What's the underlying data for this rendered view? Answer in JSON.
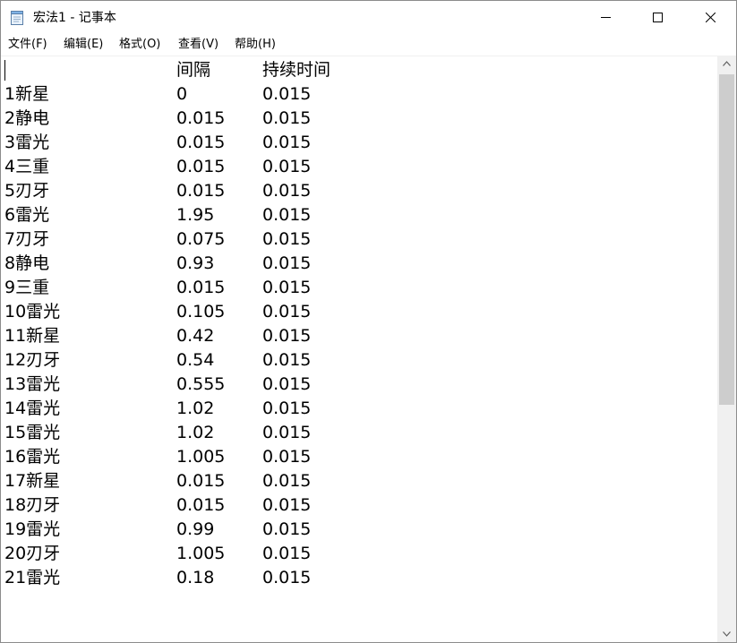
{
  "window": {
    "title": "宏法1 - 记事本"
  },
  "menu": [
    {
      "label": "文件(F)"
    },
    {
      "label": "编辑(E)"
    },
    {
      "label": "格式(O)"
    },
    {
      "label": "查看(V)"
    },
    {
      "label": "帮助(H)"
    }
  ],
  "document": {
    "header": {
      "name": "",
      "interval": "间隔",
      "duration": "持续时间"
    },
    "rows": [
      {
        "name": "1新星",
        "interval": "0",
        "duration": "0.015"
      },
      {
        "name": "2静电",
        "interval": "0.015",
        "duration": "0.015"
      },
      {
        "name": "3雷光",
        "interval": "0.015",
        "duration": "0.015"
      },
      {
        "name": "4三重",
        "interval": "0.015",
        "duration": "0.015"
      },
      {
        "name": "5刃牙",
        "interval": "0.015",
        "duration": "0.015"
      },
      {
        "name": "6雷光",
        "interval": "1.95",
        "duration": "0.015"
      },
      {
        "name": "7刃牙",
        "interval": "0.075",
        "duration": "0.015"
      },
      {
        "name": "8静电",
        "interval": "0.93",
        "duration": "0.015"
      },
      {
        "name": "9三重",
        "interval": "0.015",
        "duration": "0.015"
      },
      {
        "name": "10雷光",
        "interval": "0.105",
        "duration": "0.015"
      },
      {
        "name": "11新星",
        "interval": "0.42",
        "duration": "0.015"
      },
      {
        "name": "12刃牙",
        "interval": "0.54",
        "duration": "0.015"
      },
      {
        "name": "13雷光",
        "interval": "0.555",
        "duration": "0.015"
      },
      {
        "name": "14雷光",
        "interval": "1.02",
        "duration": "0.015"
      },
      {
        "name": "15雷光",
        "interval": "1.02",
        "duration": "0.015"
      },
      {
        "name": "16雷光",
        "interval": "1.005",
        "duration": "0.015"
      },
      {
        "name": "17新星",
        "interval": "0.015",
        "duration": "0.015"
      },
      {
        "name": "18刃牙",
        "interval": "0.015",
        "duration": "0.015"
      },
      {
        "name": "19雷光",
        "interval": "0.99",
        "duration": "0.015"
      },
      {
        "name": "20刃牙",
        "interval": "1.005",
        "duration": "0.015"
      },
      {
        "name": "21雷光",
        "interval": "0.18",
        "duration": "0.015"
      }
    ]
  },
  "scroll": {
    "position_fraction": 0.0,
    "visible_fraction": 0.6
  },
  "colors": {
    "titlebar": "#ffffff",
    "scrollbar_track": "#f0f0f0",
    "scrollbar_thumb": "#cdcdcd",
    "text": "#000000"
  },
  "icons": {
    "app": "notepad-icon",
    "minimize": "minimize-icon",
    "maximize": "maximize-icon",
    "close": "close-icon",
    "scroll_up": "chevron-up-icon",
    "scroll_down": "chevron-down-icon"
  }
}
